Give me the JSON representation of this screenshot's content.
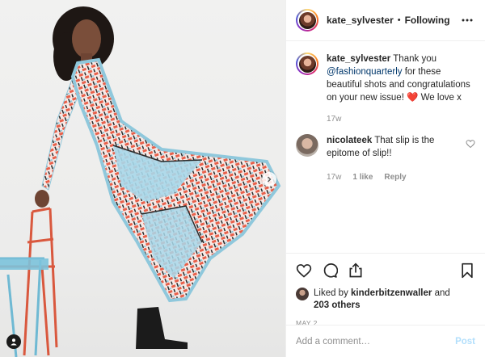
{
  "post": {
    "author": "kate_sylvester",
    "separator": "•",
    "follow_status": "Following",
    "more_icon": "more-horizontal-icon"
  },
  "comments": [
    {
      "user": "kate_sylvester",
      "text_before": " Thank you ",
      "mention": "@fashionquarterly",
      "text_after": " for these beautiful shots and congratulations on your new issue! ❤️ We love x",
      "time": "17w"
    },
    {
      "user": "nicolateek",
      "text": " That slip is the epitome of slip!!",
      "time": "17w",
      "likes": "1 like",
      "reply": "Reply"
    }
  ],
  "actions": {
    "icons": [
      "heart-icon",
      "comment-icon",
      "share-icon",
      "bookmark-icon"
    ]
  },
  "likes": {
    "prefix": "Liked by ",
    "user": "kinderbitzenwaller",
    "middle": " and",
    "others": "203 others"
  },
  "date": "MAY 2",
  "add_comment": {
    "placeholder": "Add a comment…",
    "post_label": "Post"
  },
  "colors": {
    "text": "#262626",
    "muted": "#8e8e8e",
    "mention": "#00376b",
    "post_disabled": "#b2dffc",
    "heart": "#ed4956"
  }
}
